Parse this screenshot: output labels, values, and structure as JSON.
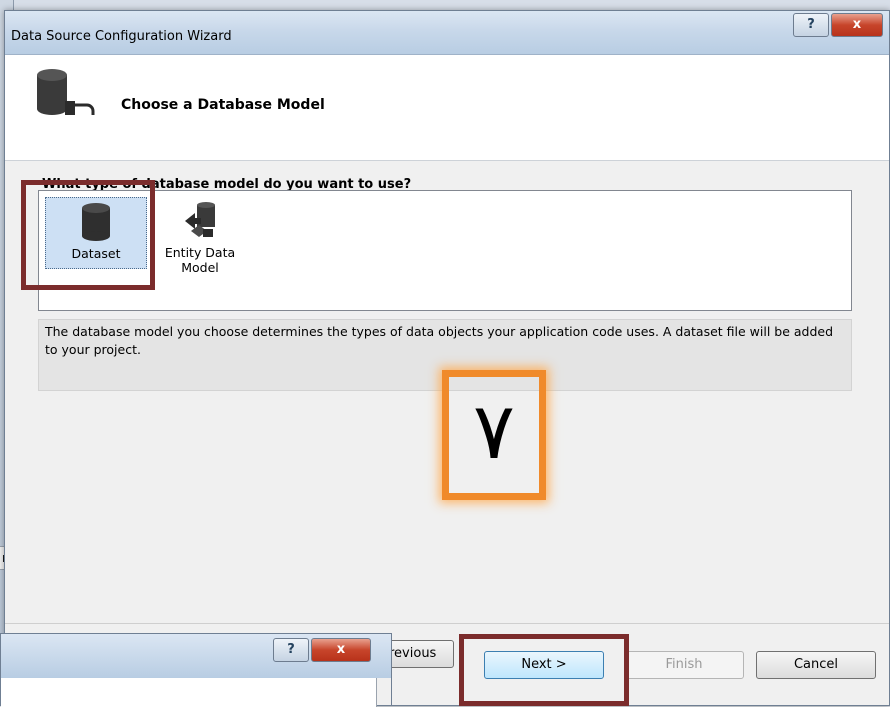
{
  "background": {
    "tab_fragment": "n"
  },
  "dialog": {
    "title": "Data Source Configuration Wizard",
    "help_label": "?",
    "close_label": "x",
    "header_title": "Choose a Database Model",
    "question": "What type of database model do you want to use?",
    "models": [
      {
        "label": "Dataset",
        "icon": "database-icon",
        "selected": true
      },
      {
        "label": "Entity Data Model",
        "icon": "entity-model-icon",
        "selected": false
      }
    ],
    "description": "The database model you choose determines the types of data objects your application code uses. A dataset file will be added to your project.",
    "step_annotation": "٧",
    "buttons": {
      "previous": "revious",
      "next": "Next >",
      "finish": "Finish",
      "cancel": "Cancel"
    }
  },
  "colors": {
    "highlight_red": "#7b2c2c",
    "highlight_orange": "#f08a2a",
    "selection": "#cde0f4"
  }
}
